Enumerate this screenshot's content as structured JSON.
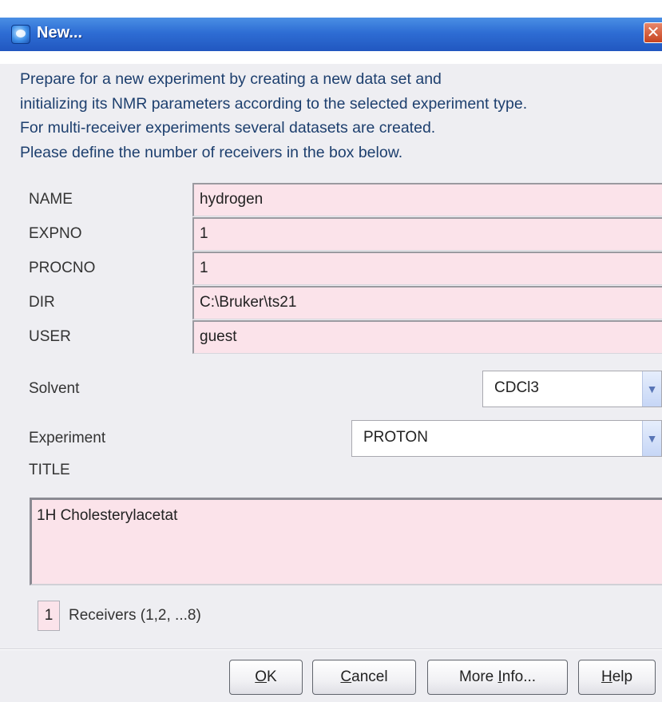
{
  "window": {
    "title": "New...",
    "close_glyph": "✕",
    "app_icon": "topspin-icon"
  },
  "intro_lines": [
    "Prepare for a new experiment by creating a new data set and",
    "initializing its NMR parameters according to the selected experiment type.",
    "For multi-receiver experiments several datasets are created.",
    "Please define the number of receivers in the box below."
  ],
  "fields": {
    "name": {
      "label": "NAME",
      "value": "hydrogen"
    },
    "expno": {
      "label": "EXPNO",
      "value": "1"
    },
    "procno": {
      "label": "PROCNO",
      "value": "1"
    },
    "dir": {
      "label": "DIR",
      "value": "C:\\Bruker\\ts21"
    },
    "user": {
      "label": "USER",
      "value": "guest"
    }
  },
  "solvent": {
    "label": "Solvent",
    "selected": "CDCl3"
  },
  "experiment": {
    "label": "Experiment",
    "selected": "PROTON"
  },
  "title": {
    "label": "TITLE",
    "value": "1H Cholesterylacetat"
  },
  "receivers": {
    "value": "1",
    "label": "Receivers (1,2, ...8)"
  },
  "buttons": {
    "ok": {
      "mnemonic": "O",
      "rest": "K"
    },
    "cancel": {
      "mnemonic": "C",
      "rest": "ancel"
    },
    "more_info": {
      "prefix": "More ",
      "mnemonic": "I",
      "rest": "nfo..."
    },
    "help": {
      "mnemonic": "H",
      "rest": "elp"
    }
  },
  "colors": {
    "title_bar": "#2e6dd4",
    "field_background": "#fbe3ea",
    "intro_text": "#1d3f6e"
  }
}
